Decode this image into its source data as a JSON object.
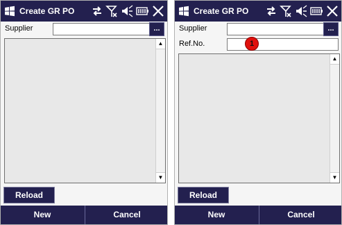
{
  "screens": [
    {
      "title": "Create GR PO",
      "fields": [
        {
          "label": "Supplier",
          "value": ""
        }
      ],
      "browse_label": "...",
      "reload_label": "Reload",
      "new_label": "New",
      "cancel_label": "Cancel"
    },
    {
      "title": "Create GR PO",
      "fields": [
        {
          "label": "Supplier",
          "value": ""
        },
        {
          "label": "Ref.No.",
          "value": ""
        }
      ],
      "browse_label": "...",
      "reload_label": "Reload",
      "new_label": "New",
      "cancel_label": "Cancel",
      "annotation": "1"
    }
  ],
  "status_icons": [
    "sync-arrows-icon",
    "signal-off-icon",
    "speaker-mute-icon",
    "battery-icon",
    "close-icon"
  ],
  "colors": {
    "titlebar": "#23204f",
    "marker": "#e0100c",
    "list_background": "#e8e8e8"
  }
}
